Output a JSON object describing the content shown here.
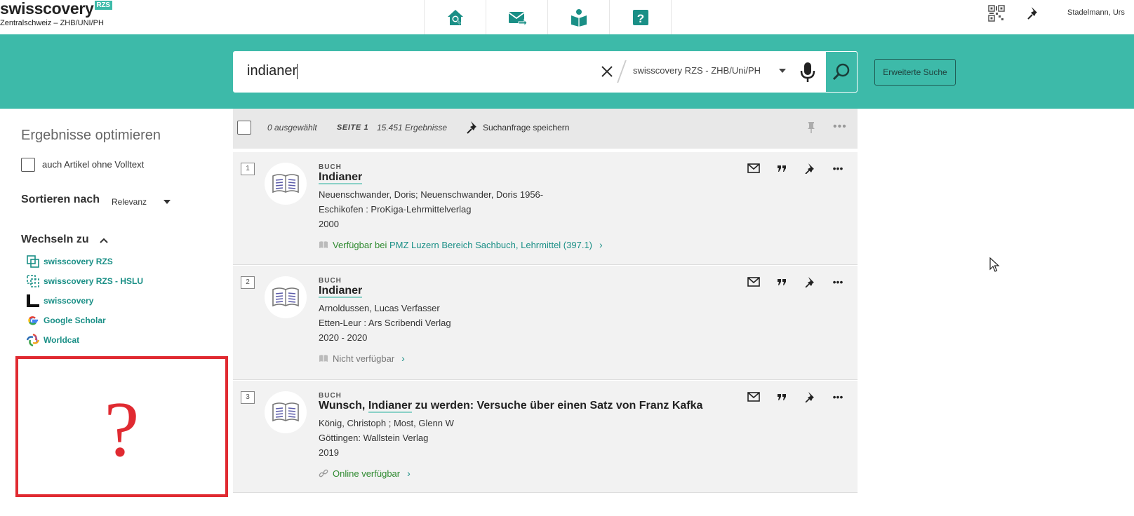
{
  "header": {
    "logo": "swisscovery",
    "logo_badge": "RZS",
    "logo_sub": "Zentralschweiz – ZHB/UNI/PH",
    "nav": [
      {
        "icon": "home-search-icon"
      },
      {
        "icon": "mail-forward-icon"
      },
      {
        "icon": "book-reader-icon"
      },
      {
        "icon": "help-icon"
      }
    ],
    "user": "Stadelmann, Urs"
  },
  "search": {
    "query": "indianer",
    "scope": "swisscovery RZS - ZHB/Uni/PH",
    "advanced": "Erweiterte Suche",
    "accent": "#3dbaa9"
  },
  "sidebar": {
    "title": "Ergebnisse optimieren",
    "fulltext_label": "auch Artikel ohne Volltext",
    "sort_label": "Sortieren nach",
    "sort_value": "Relevanz",
    "switch_label": "Wechseln zu",
    "links": [
      {
        "label": "swisscovery RZS",
        "icon": "copy-icon"
      },
      {
        "label": "swisscovery RZS - HSLU",
        "icon": "dashed-copy-icon"
      },
      {
        "label": "swisscovery",
        "icon": "swisscovery-l-icon"
      },
      {
        "label": "Google Scholar",
        "icon": "google-icon"
      },
      {
        "label": "Worldcat",
        "icon": "worldcat-icon"
      }
    ],
    "question_mark": "?"
  },
  "results_bar": {
    "selected": "0 ausgewählt",
    "page": "SEITE 1",
    "count": "15.451 Ergebnisse",
    "save_query": "Suchanfrage speichern"
  },
  "results": [
    {
      "num": "1",
      "type": "BUCH",
      "title_hl": "Indianer",
      "title_rest": "",
      "authors": "Neuenschwander, Doris; Neuenschwander, Doris 1956-",
      "publisher": "Eschikofen : ProKiga-Lehrmittelverlag",
      "year": "2000",
      "avail_prefix": "Verfügbar bei",
      "avail_link": "PMZ Luzern  Bereich Sachbuch, Lehrmittel (397.1)"
    },
    {
      "num": "2",
      "type": "BUCH",
      "title_hl": "Indianer",
      "title_rest": "",
      "authors": "Arnoldussen, Lucas Verfasser",
      "publisher": "Etten-Leur : Ars Scribendi Verlag",
      "year": "2020 - 2020",
      "avail_prefix": "Nicht verfügbar",
      "avail_link": ""
    },
    {
      "num": "3",
      "type": "BUCH",
      "title_pre": "Wunsch, ",
      "title_hl": "Indianer",
      "title_rest": " zu werden: Versuche über einen Satz von Franz Kafka",
      "authors": "König, Christoph ; Most, Glenn W",
      "publisher": "Göttingen: Wallstein Verlag",
      "year": "2019",
      "avail_prefix": "Online verfügbar",
      "avail_link": ""
    }
  ]
}
